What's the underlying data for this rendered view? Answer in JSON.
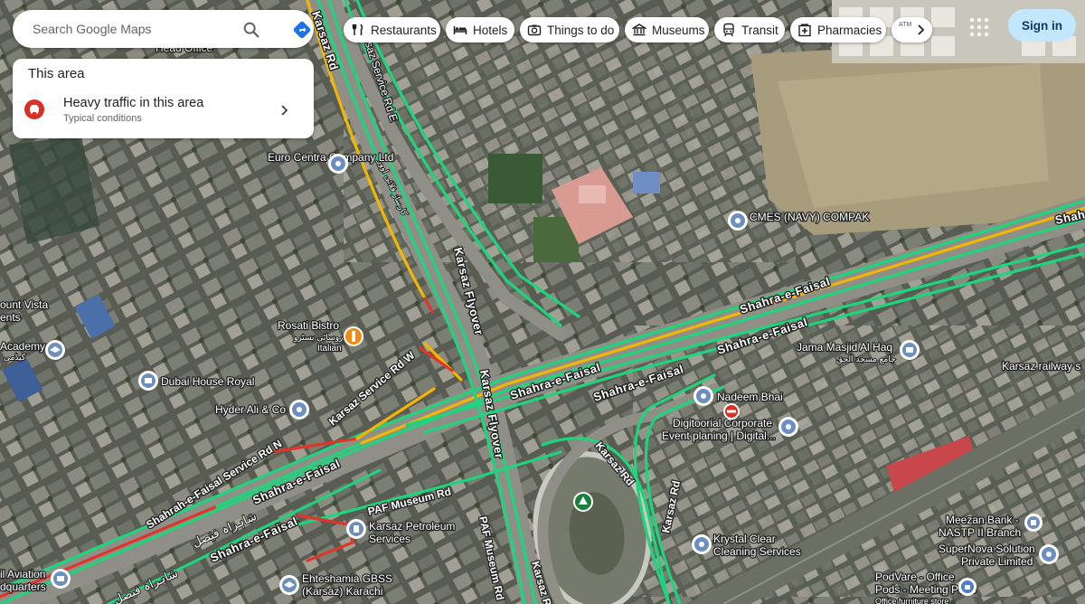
{
  "search": {
    "placeholder": "Search Google Maps",
    "search_icon": "search-icon",
    "directions_icon": "directions-icon"
  },
  "area_card": {
    "title": "This area",
    "traffic": {
      "title": "Heavy traffic in this area",
      "subtitle": "Typical conditions",
      "icon": "car-icon",
      "color": "#d93025"
    }
  },
  "chips": [
    {
      "label": "Restaurants",
      "icon": "fork-knife-icon"
    },
    {
      "label": "Hotels",
      "icon": "bed-icon"
    },
    {
      "label": "Things to do",
      "icon": "camera-icon"
    },
    {
      "label": "Museums",
      "icon": "museum-icon"
    },
    {
      "label": "Transit",
      "icon": "train-icon"
    },
    {
      "label": "Pharmacies",
      "icon": "pharmacy-icon"
    }
  ],
  "chip_more": {
    "partial_label": "ATM",
    "icon": "chevron-right-icon"
  },
  "header": {
    "sign_in": "Sign in",
    "apps_icon": "apps-grid-icon"
  },
  "colors": {
    "traffic_fast": "#1ed47c",
    "traffic_slow": "#f2b705",
    "traffic_heavy": "#e0352b",
    "pin": "#4f7cc4",
    "food_pin": "#f28b16",
    "park_pin": "#188038"
  },
  "places": {
    "road_karsaz_rd_top": "Karsaz Rd",
    "road_karsaz_service_e": "Karsaz Service Rd E",
    "road_karsaz_flyover": "Karsaz Flyover",
    "road_flyover_urdu": "کارساز فلائی اوور",
    "road_shahra_1": "Shahra-e-Faisal",
    "road_shahra_2": "Shahra-e-Faisal",
    "road_shahra_3": "Shahra-e-Faisal",
    "road_shahra_4": "Shahra-e-Faisal",
    "road_shahra_5": "Shahra-e-Faisal",
    "road_shahra_6": "Shahra-e-Faisal",
    "road_shahra_edge": "Shah",
    "road_shahra_urdu": "شاہراہ فیصل",
    "road_shahra_urdu_2": "شاہراہ فیصل",
    "road_karsaz_service_w": "Karsaz Service Rd W",
    "road_service_n": "Shahrah-e-Faisal Service Rd N",
    "road_paf_museum_1": "PAF Museum Rd",
    "road_paf_museum_2": "PAF Museum Rd",
    "road_karsaz_rd_mid": "Karsaz Rd",
    "road_karsaz_rd_low": "Karsaz Rd",
    "road_karsaz_rd_bottom": "Karsaz R",
    "road_karsaz_railway": "Karsaz railway s",
    "head_office": "Head Office",
    "euro_centra": "Euro Centra Company Ltd",
    "cmes": "CMES (NAVY) COMPAK",
    "rosati_bistro": "Rosati Bistro",
    "rosati_urdu": "روساٹی بسٹرو",
    "rosati_type": "Italian",
    "mount_vista": "ount Vista",
    "mount_vista_2": "ents",
    "academy": "Academy",
    "academy_urdu": "کیڈمی",
    "dubai_house": "Dubai House Royal",
    "hyder_ali": "Hyder Ali & Co",
    "jama_masjid": "Jama Masjid Al Haq",
    "jama_urdu": "جامع مسجد الحق",
    "nadeem_bhai": "Nadeem Bhai",
    "digitoorial": "Digitoorial Corporate",
    "digitoorial_2": "Event planing | Digital...",
    "karsaz_petroleum": "Karsaz Petroleum",
    "karsaz_petroleum_2": "Services",
    "krystal_clear": "Krystal Clear",
    "krystal_clear_2": "Cleaning Services",
    "meezan_bank": "Meezan Bank -",
    "meezan_bank_2": "NASTP II Branch",
    "supernova": "SuperNova Solution",
    "supernova_2": "Private Limited",
    "ehteshamia": "Ehteshamia GBSS",
    "ehteshamia_2": "(Karsaz) Karachi",
    "aviation": "il Aviation",
    "aviation_2": "dquarters",
    "podvare": "PodVare - Office",
    "podvare_2": "Pods - Meeting Pods",
    "podvare_3": "Office furniture store"
  }
}
